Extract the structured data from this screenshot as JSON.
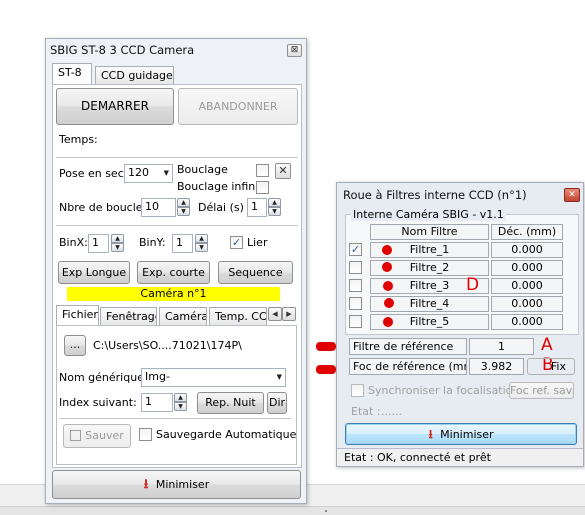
{
  "sbig_window": {
    "title": "SBIG ST-8 3 CCD Camera",
    "tabs": [
      "ST-8",
      "CCD guidage"
    ],
    "start_label": "DEMARRER",
    "abort_label": "ABANDONNER",
    "time_label": "Temps:",
    "exposure_label": "Pose en sec.",
    "exposure_value": "120",
    "loop_label": "Bouclage",
    "loop_infinite_label": "Bouclage infini",
    "loop_count_label": "Nbre de boucles",
    "loop_count_value": "10",
    "delay_label": "Délai (s)",
    "delay_value": "1",
    "binx_label": "BinX:",
    "binx_value": "1",
    "biny_label": "BinY:",
    "biny_value": "1",
    "link_label": "Lier",
    "link_checked": true,
    "long_exp_label": "Exp Longue",
    "short_exp_label": "Exp. courte",
    "sequence_label": "Sequence",
    "camera_banner": "Caméra n°1",
    "lower_tabs": [
      "Fichier",
      "Fenêtrage",
      "Caméra",
      "Temp. CCD"
    ],
    "browse_label": "...",
    "path_value": "C:\\Users\\SO....71021\\174P\\",
    "generic_name_label": "Nom générique:",
    "generic_name_value": "Img-",
    "next_index_label": "Index suivant:",
    "next_index_value": "1",
    "night_rep_label": "Rep. Nuit",
    "dir_label": "Dir",
    "save_label": "Sauver",
    "auto_save_label": "Sauvegarde Automatique",
    "minimize_label": "Minimiser"
  },
  "filter_window": {
    "title": "Roue à Filtres interne CCD (n°1)",
    "group_label": "Interne Caméra SBIG - v1.1",
    "col_filter_name": "Nom Filtre",
    "col_offset": "Déc. (mm)",
    "filters": [
      {
        "name": "Filtre_1",
        "offset": "0.000",
        "checked": true
      },
      {
        "name": "Filtre_2",
        "offset": "0.000",
        "checked": false
      },
      {
        "name": "Filtre_3",
        "offset": "0.000",
        "checked": false
      },
      {
        "name": "Filtre_4",
        "offset": "0.000",
        "checked": false
      },
      {
        "name": "Filtre_5",
        "offset": "0.000",
        "checked": false
      }
    ],
    "ref_filter_label": "Filtre de référence",
    "ref_filter_value": "1",
    "ref_focus_label": "Foc de référence (mm)",
    "ref_focus_value": "3.982",
    "fix_label": "Fix",
    "sync_focus_label": "Synchroniser la focalisation",
    "save_ref_focus_label": "Foc ref. sav.",
    "state_label": "Etat :",
    "state_value": "......",
    "minimize_label": "Minimiser",
    "status_text": "Etat : OK, connecté et prêt"
  },
  "annotations": {
    "a": "A",
    "b": "B",
    "d": "D"
  },
  "colors": {
    "annotation_red": "#e00000",
    "banner_yellow": "#ffff00",
    "minimize_arrow": "#d0261a"
  }
}
